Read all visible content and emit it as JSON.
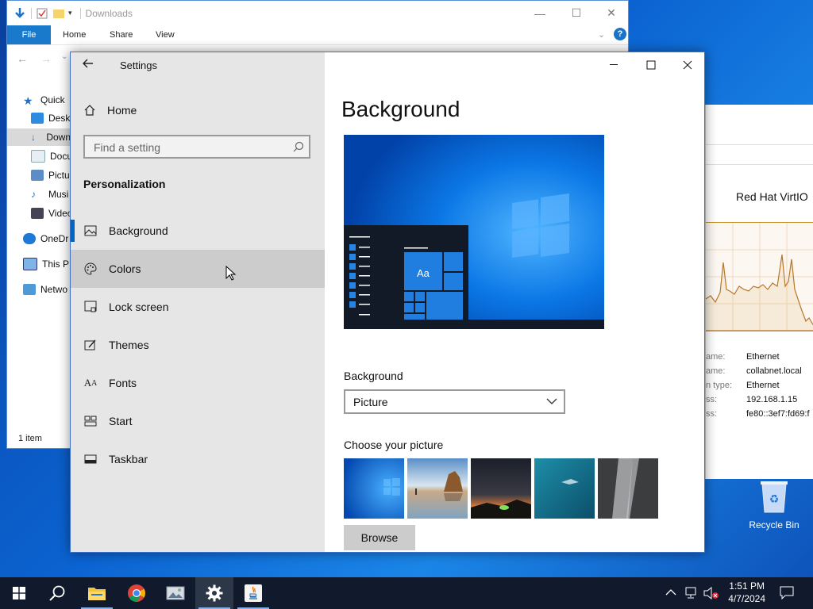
{
  "explorer": {
    "title": "Downloads",
    "ribbon_tabs": [
      "File",
      "Home",
      "Share",
      "View"
    ],
    "tree": [
      "Quick",
      "Deskt",
      "Down",
      "Docu",
      "Pictu",
      "Musi",
      "Video",
      "OneDr",
      "This P",
      "Netwo"
    ],
    "status": "1 item"
  },
  "perf": {
    "title": "Red Hat VirtIO",
    "rows": [
      {
        "k": "ame:",
        "v": "Ethernet"
      },
      {
        "k": "ame:",
        "v": "collabnet.local"
      },
      {
        "k": "n type:",
        "v": "Ethernet"
      },
      {
        "k": "ss:",
        "v": "192.168.1.15"
      },
      {
        "k": "ss:",
        "v": "fe80::3ef7:fd69:f"
      }
    ]
  },
  "desktop": {
    "recycle_bin": "Recycle Bin"
  },
  "settings": {
    "app_title": "Settings",
    "home": "Home",
    "search_placeholder": "Find a setting",
    "section": "Personalization",
    "nav": [
      {
        "label": "Background",
        "icon": "picture-icon"
      },
      {
        "label": "Colors",
        "icon": "palette-icon"
      },
      {
        "label": "Lock screen",
        "icon": "lock-screen-icon"
      },
      {
        "label": "Themes",
        "icon": "themes-icon"
      },
      {
        "label": "Fonts",
        "icon": "fonts-icon"
      },
      {
        "label": "Start",
        "icon": "start-icon"
      },
      {
        "label": "Taskbar",
        "icon": "taskbar-icon"
      }
    ],
    "page_title": "Background",
    "preview_tile_text": "Aa",
    "background_label": "Background",
    "background_value": "Picture",
    "choose_label": "Choose your picture",
    "browse": "Browse"
  },
  "taskbar": {
    "time": "1:51 PM",
    "date": "4/7/2024"
  },
  "colors": {
    "accent": "#0067c0",
    "taskbar": "#101a2c",
    "file_tab": "#1979ca"
  }
}
